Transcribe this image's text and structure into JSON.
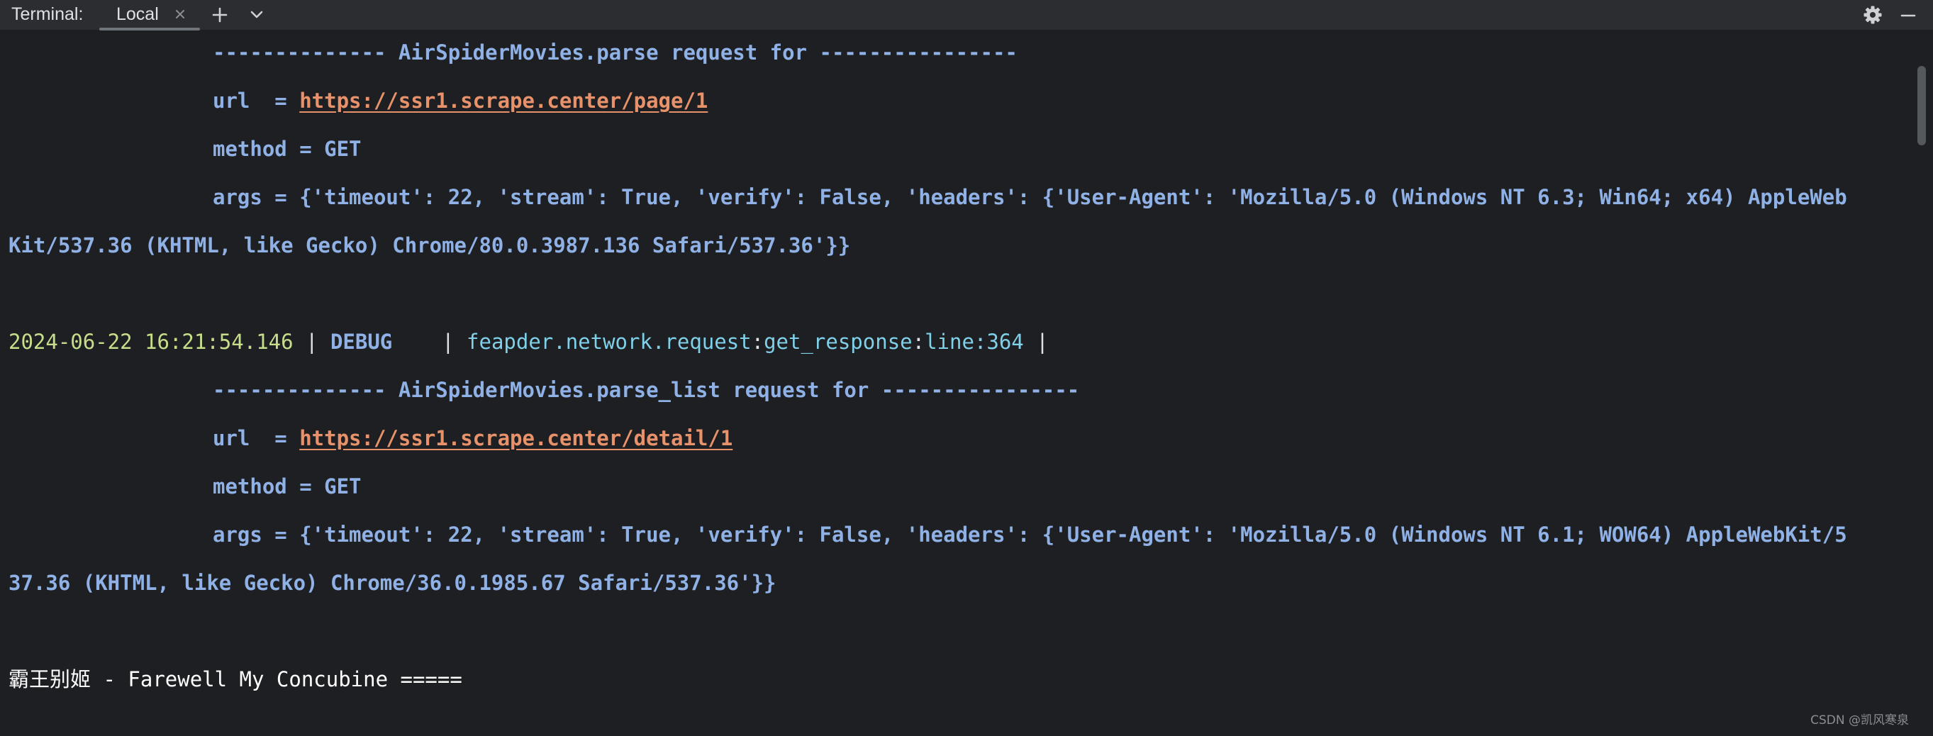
{
  "toolbar": {
    "title": "Terminal:",
    "tab_label": "Local",
    "icons": [
      "close-icon",
      "plus-icon",
      "chevron-down-icon",
      "gear-icon",
      "minimize-icon"
    ]
  },
  "terminal": {
    "block1": {
      "header": "-------------- AirSpiderMovies.parse request for ----------------",
      "url_prefix": "url  = ",
      "url": "https://ssr1.scrape.center/page/1",
      "method": "method = GET",
      "args_line1": "args = {'timeout': 22, 'stream': True, 'verify': False, 'headers': {'User-Agent': 'Mozilla/5.0 (Windows NT 6.3; Win64; x64) AppleWeb",
      "args_line2": "Kit/537.36 (KHTML, like Gecko) Chrome/80.0.3987.136 Safari/537.36'}}"
    },
    "log": {
      "timestamp": "2024-06-22 16:21:54.146",
      "sep1": " | ",
      "level": "DEBUG   ",
      "sep2": " | ",
      "module": "feapder.network.request",
      "colon1": ":",
      "function": "get_response",
      "colon2": ":",
      "line": "line:364",
      "sep3": " |"
    },
    "block2": {
      "header": "-------------- AirSpiderMovies.parse_list request for ----------------",
      "url_prefix": "url  = ",
      "url": "https://ssr1.scrape.center/detail/1",
      "method": "method = GET",
      "args_line1": "args = {'timeout': 22, 'stream': True, 'verify': False, 'headers': {'User-Agent': 'Mozilla/5.0 (Windows NT 6.1; WOW64) AppleWebKit/5",
      "args_line2": "37.36 (KHTML, like Gecko) Chrome/36.0.1985.67 Safari/537.36'}}"
    },
    "output": {
      "cjk": "霸王别姬",
      "rest": " - Farewell My Concubine ====="
    }
  },
  "watermark": "CSDN @凯风寒泉",
  "colors": {
    "terminal_bg": "#1e1f22",
    "toolbar_bg": "#2b2d30",
    "text_blue": "#8fb1e6",
    "link": "#e8926b",
    "timestamp": "#c6dd8a",
    "module": "#7fd0e8"
  }
}
